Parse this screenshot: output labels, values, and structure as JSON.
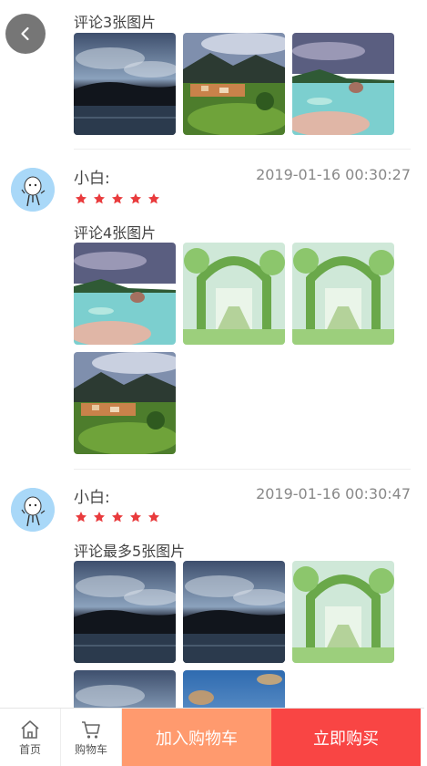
{
  "back_icon": "chevron-left-icon",
  "comments": [
    {
      "text": "评论3张图片",
      "photos": [
        "photo-mountain-lake-dusk",
        "photo-village-valley",
        "photo-tropical-beach-rocks"
      ]
    },
    {
      "user": "小白:",
      "time": "2019-01-16 00:30:27",
      "rating": 5,
      "text": "评论4张图片",
      "photos": [
        "photo-tropical-beach-rocks",
        "photo-garden-arch",
        "photo-garden-arch",
        "photo-village-valley"
      ]
    },
    {
      "user": "小白:",
      "time": "2019-01-16 00:30:47",
      "rating": 5,
      "text": "评论最多5张图片",
      "photos": [
        "photo-mountain-lake-dusk",
        "photo-mountain-lake-dusk",
        "photo-garden-arch",
        "photo-mountain-lake-dusk",
        "photo-sky-sunset"
      ]
    }
  ],
  "bottom_bar": {
    "home_label": "首页",
    "cart_label": "购物车",
    "add_to_cart": "加入购物车",
    "buy_now": "立即购买"
  },
  "colors": {
    "star": "#e93b3d",
    "add_to_cart_bg": "#ff9a6e",
    "buy_now_bg": "#f94544"
  }
}
